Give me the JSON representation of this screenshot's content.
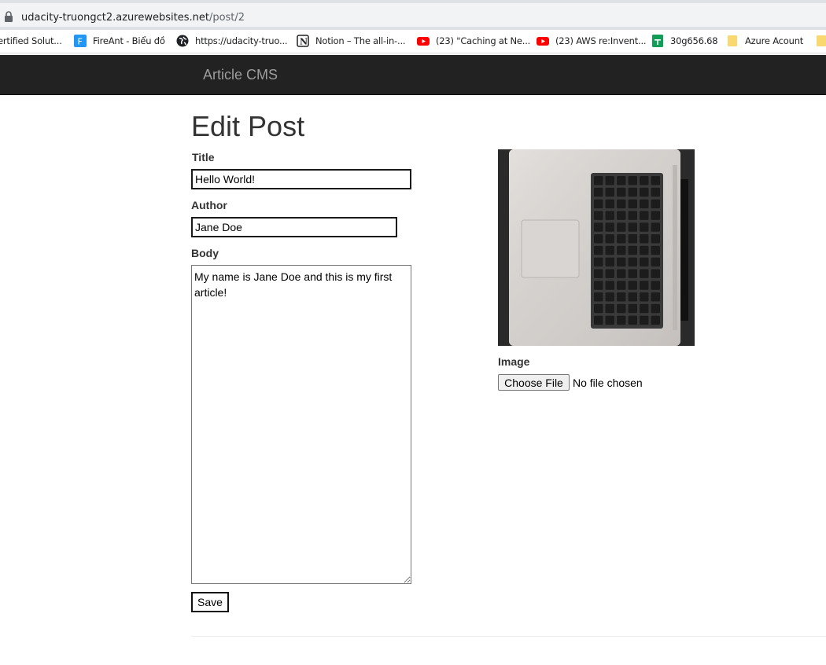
{
  "browser": {
    "url_host": "udacity-truongct2.azurewebsites.net",
    "url_path": "/post/2",
    "bookmarks": [
      {
        "label": "ertified Solut...",
        "icon": "bookmark-icon"
      },
      {
        "label": "FireAnt - Biểu đồ",
        "icon": "fireant-icon"
      },
      {
        "label": "https://udacity-truo...",
        "icon": "globe-icon"
      },
      {
        "label": "Notion – The all-in-...",
        "icon": "notion-icon"
      },
      {
        "label": "(23) \"Caching at Ne...",
        "icon": "youtube-icon"
      },
      {
        "label": "(23) AWS re:Invent...",
        "icon": "youtube-icon"
      },
      {
        "label": "30g656.68",
        "icon": "sheets-icon"
      },
      {
        "label": "Azure Acount",
        "icon": "folder-icon"
      }
    ]
  },
  "navbar": {
    "brand": "Article CMS"
  },
  "form": {
    "page_title": "Edit Post",
    "title_label": "Title",
    "title_value": "Hello World!",
    "author_label": "Author",
    "author_value": "Jane Doe",
    "body_label": "Body",
    "body_value": "My name is Jane Doe and this is my first article!",
    "save_label": "Save",
    "image_label": "Image",
    "choose_file_label": "Choose File",
    "no_file_text": "No file chosen"
  },
  "colors": {
    "navbar_bg": "#222222",
    "brand": "#9d9d9d",
    "youtube": "#ff0000",
    "sheets": "#0f9d58",
    "fireant": "#2196f3",
    "folder": "#f9d870"
  }
}
